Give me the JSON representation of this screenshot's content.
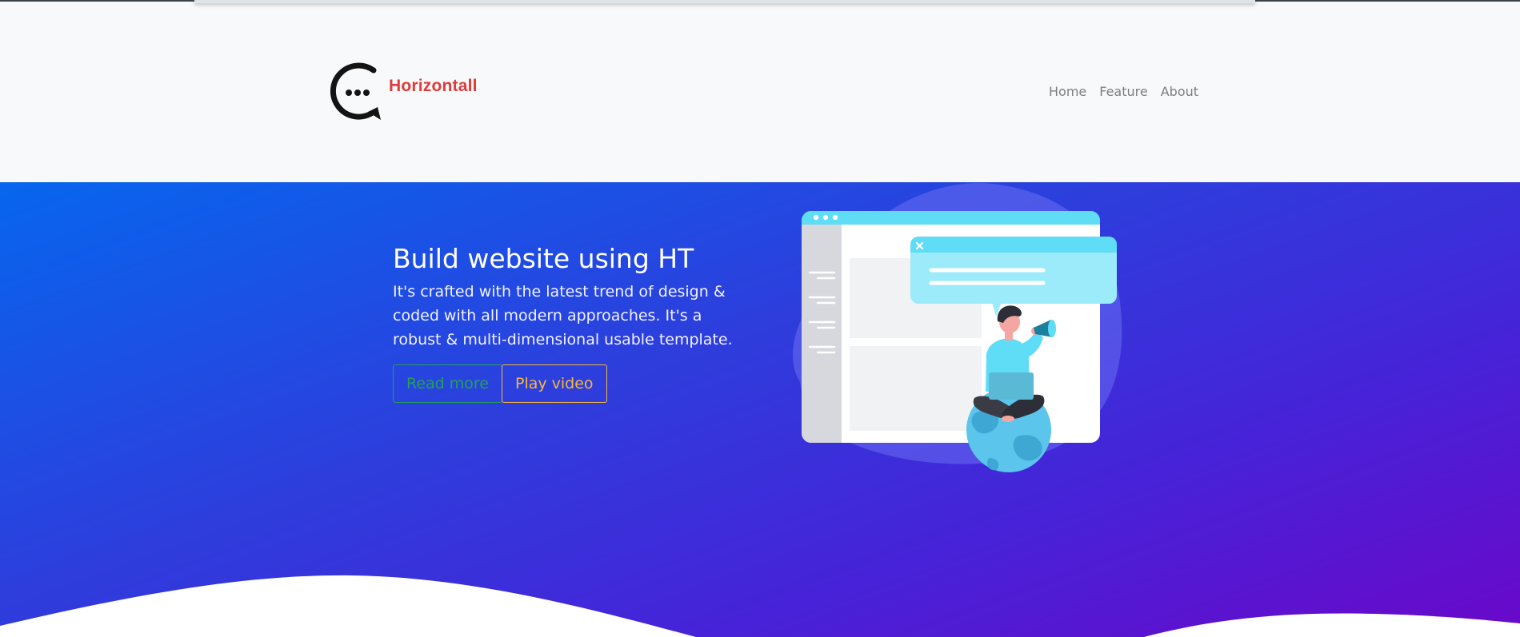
{
  "brand": {
    "name": "Horizontall",
    "logo_icon": "chat-bubble-logo-icon",
    "name_color": "#e03a3a"
  },
  "nav": {
    "items": [
      {
        "label": "Home"
      },
      {
        "label": "Feature"
      },
      {
        "label": "About"
      }
    ]
  },
  "hero": {
    "title": "Build website using HT",
    "description": "It's crafted with the latest trend of design & coded with all modern approaches. It's a robust & multi-dimensional usable template.",
    "buttons": {
      "read_more": "Read more",
      "play_video": "Play video"
    },
    "illustration": "person-on-globe-with-megaphone-browser-illustration",
    "colors": {
      "gradient_start": "#0766ee",
      "gradient_end": "#6a08c9",
      "read_more": "#23a057",
      "play_video": "#f6b73c"
    }
  }
}
